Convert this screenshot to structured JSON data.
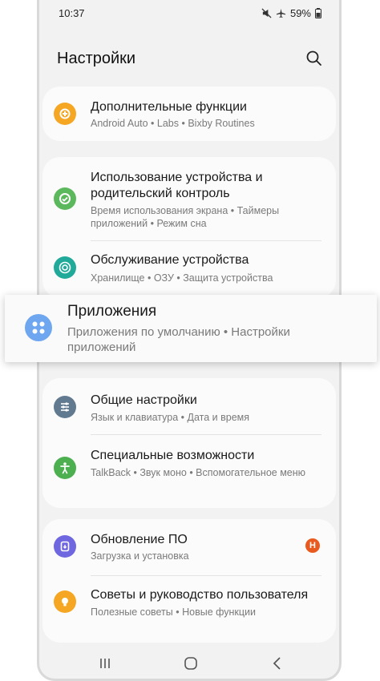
{
  "status_bar": {
    "time": "10:37",
    "battery": "59%"
  },
  "header": {
    "title": "Настройки"
  },
  "cards": [
    {
      "items": [
        {
          "title": "Дополнительные функции",
          "subtitle": "Android Auto  •  Labs  •  Bixby Routines",
          "icon": "plus-gear-icon",
          "color": "#f5a623"
        }
      ]
    },
    {
      "items": [
        {
          "title": "Использование устройства и родительский контроль",
          "subtitle": "Время использования экрана  •  Таймеры приложений  •  Режим сна",
          "icon": "digital-wellbeing-icon",
          "color": "#5cb85c"
        },
        {
          "title": "Обслуживание устройства",
          "subtitle": "Хранилище  •  ОЗУ  •  Защита устройства",
          "icon": "device-care-icon",
          "color": "#21a99a"
        }
      ]
    },
    {
      "items": [
        {
          "title": "Общие настройки",
          "subtitle": "Язык и клавиатура  •  Дата и время",
          "icon": "sliders-icon",
          "color": "#617a8f"
        },
        {
          "title": "Специальные возможности",
          "subtitle": "TalkBack  •  Звук моно  •  Вспомогательное меню",
          "icon": "accessibility-icon",
          "color": "#4caf50"
        }
      ]
    },
    {
      "items": [
        {
          "title": "Обновление ПО",
          "subtitle": "Загрузка и установка",
          "icon": "software-update-icon",
          "color": "#6f67e0",
          "badge": "H"
        },
        {
          "title": "Советы и руководство пользователя",
          "subtitle": "Полезные советы  •  Новые функции",
          "icon": "tips-bulb-icon",
          "color": "#f5a623"
        }
      ]
    }
  ],
  "highlight": {
    "title": "Приложения",
    "subtitle": "Приложения по умолчанию  •  Настройки приложений",
    "icon": "apps-grid-icon",
    "color": "#6ea6f0"
  }
}
